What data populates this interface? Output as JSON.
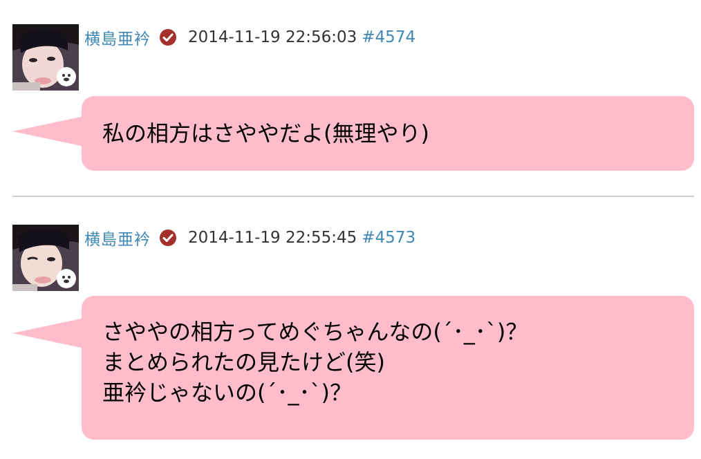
{
  "feed": {
    "posts": [
      {
        "author": "横島亜衿",
        "verified_icon": "verified-check-icon",
        "timestamp": "2014-11-19 22:56:03",
        "post_id": "#4574",
        "message_lines": [
          "私の相方はさややだよ(無理やり)"
        ]
      },
      {
        "author": "横島亜衿",
        "verified_icon": "verified-check-icon",
        "timestamp": "2014-11-19 22:55:45",
        "post_id": "#4573",
        "message_lines": [
          "さややの相方ってめぐちゃんなの(´･_･`)？",
          "まとめられたの見たけど(笑)",
          "亜衿じゃないの(´･_･`)？"
        ]
      }
    ]
  },
  "colors": {
    "link": "#3f87b4",
    "bubble": "#ffbdcb",
    "verified": "#a3302b",
    "divider": "#cfcfcf"
  }
}
